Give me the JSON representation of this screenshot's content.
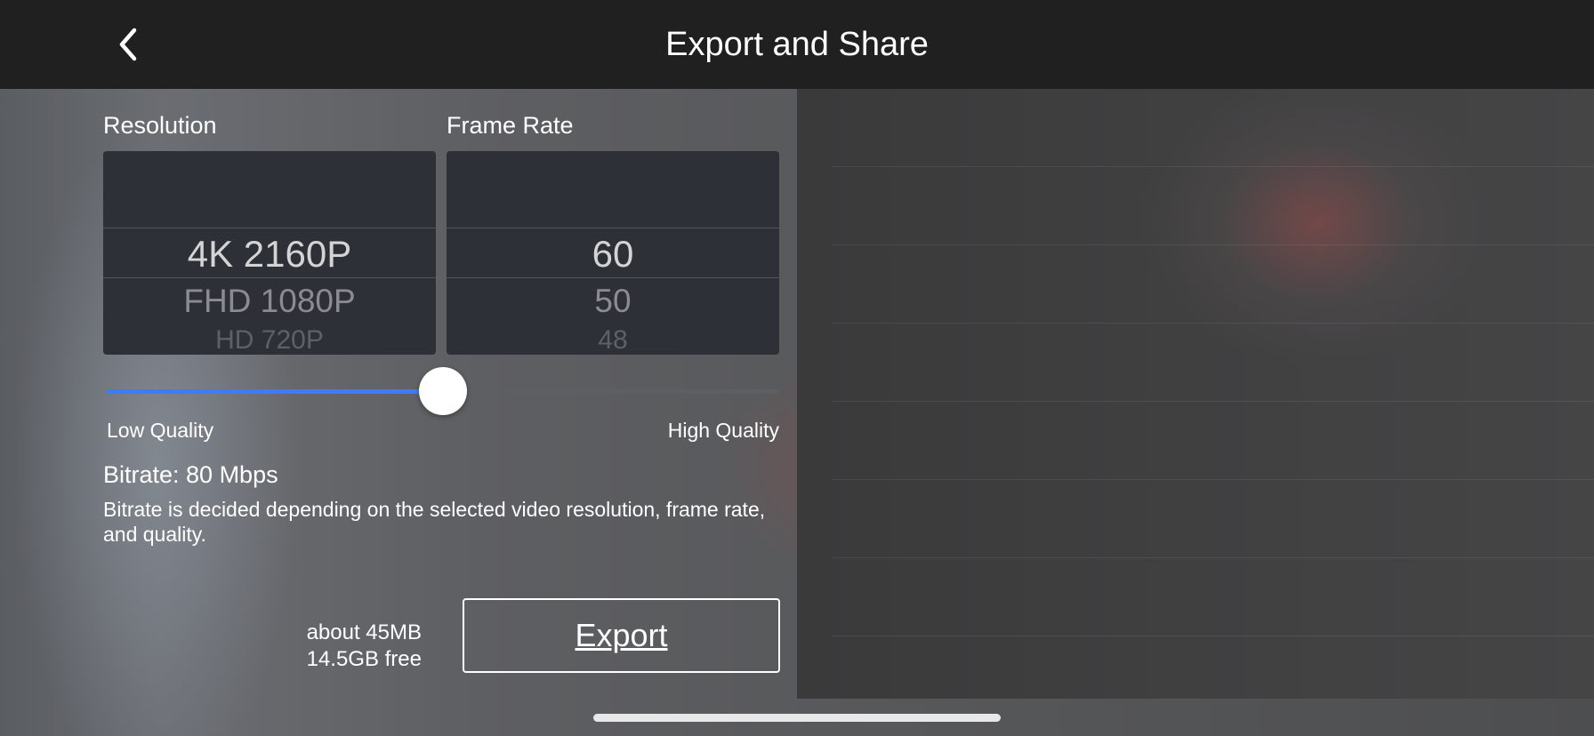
{
  "header": {
    "title": "Export and Share",
    "back_icon": "chevron-left-icon"
  },
  "resolution": {
    "label": "Resolution",
    "selected": "4K 2160P",
    "options": [
      "4K 2160P",
      "FHD 1080P",
      "HD 720P"
    ]
  },
  "frame_rate": {
    "label": "Frame Rate",
    "selected": "60",
    "options": [
      "60",
      "50",
      "48"
    ]
  },
  "quality": {
    "low_label": "Low Quality",
    "high_label": "High Quality",
    "value": 0.5,
    "accent_color": "#3c7ef0"
  },
  "bitrate": {
    "value_text": "Bitrate: 80 Mbps",
    "description": "Bitrate is decided depending on the selected video resolution, frame rate, and quality."
  },
  "storage": {
    "estimated_size": "about 45MB",
    "free_space": "14.5GB free"
  },
  "export_button": {
    "label": "Export"
  }
}
